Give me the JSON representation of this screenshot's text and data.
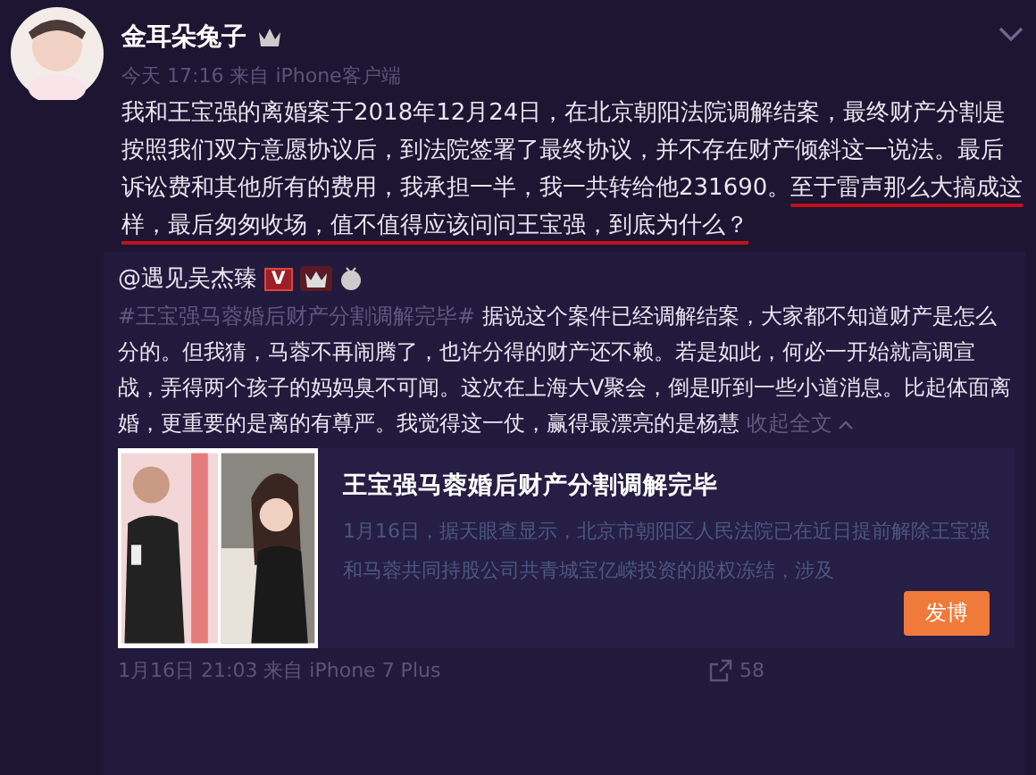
{
  "post": {
    "author": "金耳朵兔子",
    "meta": "今天 17:16 来自 iPhone客户端",
    "text": "我和王宝强的离婚案于2018年12月24日，在北京朝阳法院调解结案，最终财产分割是按照我们双方意愿协议后，到法院签署了最终协议，并不存在财产倾斜这一说法。最后诉讼费和其他所有的费用，我承担一半，我一共转给他231690。",
    "highlighted_text": "至于雷声那么大搞成这样，最后匆匆收场，值不值得应该问问王宝强，到底为什么？"
  },
  "repost": {
    "author": "@遇见吴杰臻",
    "badge": "V",
    "hashtag": "#王宝强马蓉婚后财产分割调解完毕#",
    "text": "据说这个案件已经调解结案，大家都不知道财产是怎么分的。但我猜，马蓉不再闹腾了，也许分得的财产还不赖。若是如此，何必一开始就高调宣战，弄得两个孩子的妈妈臭不可闻。这次在上海大V聚会，倒是听到一些小道消息。比起体面离婚，更重要的是离的有尊严。我觉得这一仗，赢得最漂亮的是杨慧",
    "collapse_link": "收起全文",
    "card": {
      "title": "王宝强马蓉婚后财产分割调解完毕",
      "description": "1月16日，据天眼查显示，北京市朝阳区人民法院已在近日提前解除王宝强和马蓉共同持股公司共青城宝亿嵘投资的股权冻结，涉及",
      "button": "发博"
    },
    "meta": "1月16日 21:03 来自 iPhone 7 Plus",
    "share_count": "58"
  }
}
